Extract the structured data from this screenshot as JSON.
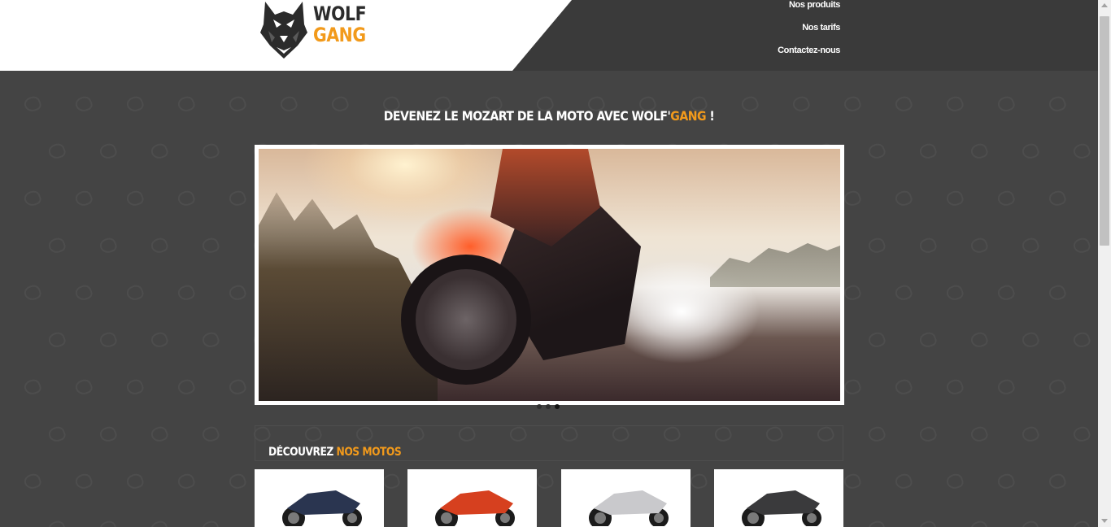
{
  "header": {
    "logo": {
      "line1": "WOLF",
      "line2": "GANG",
      "icon": "wolf-icon"
    },
    "nav": [
      {
        "label": "Nos produits"
      },
      {
        "label": "Nos tarifs"
      },
      {
        "label": "Contactez-nous"
      }
    ]
  },
  "hero": {
    "headline_part1": "DEVENEZ LE MOZART DE LA MOTO AVEC WOLF'",
    "headline_highlight": "GANG",
    "headline_end": " !",
    "slider": {
      "slide_count": 3,
      "active_slide": 3
    }
  },
  "products": {
    "title_part1": "DÉCOUVREZ ",
    "title_highlight": "NOS MOTOS",
    "items": [
      {
        "color": "#2a3550",
        "icon": "motorcycle-icon"
      },
      {
        "color": "#d6401f",
        "icon": "motorcycle-icon"
      },
      {
        "color": "#c9c9cc",
        "icon": "motorcycle-icon"
      },
      {
        "color": "#3a3a3c",
        "icon": "motorcycle-icon"
      }
    ]
  },
  "colors": {
    "accent": "#f29a1b",
    "background": "#444444",
    "header_dark": "#3a3a3a"
  }
}
